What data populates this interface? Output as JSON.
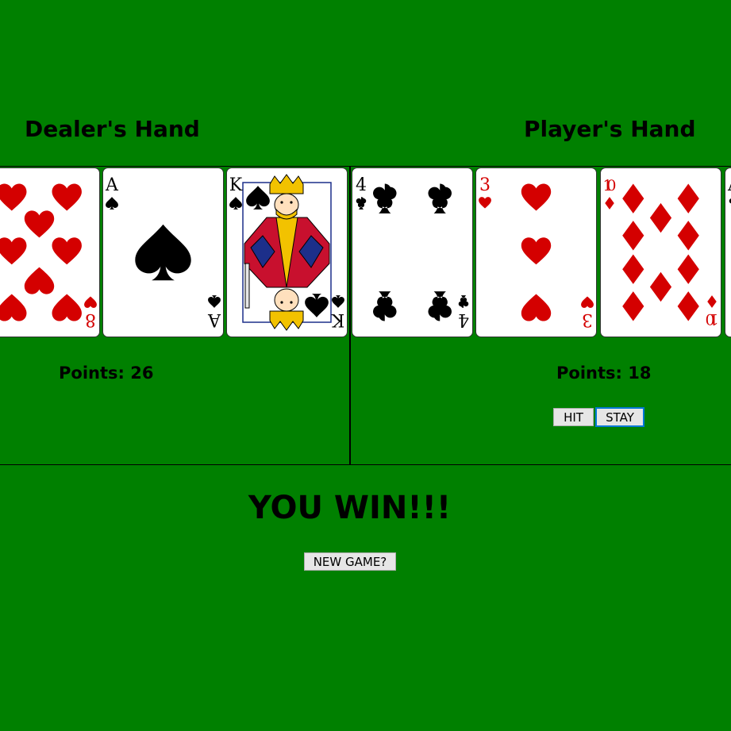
{
  "dealer": {
    "title": "Dealer's Hand",
    "points_label": "Points: 26",
    "cards": [
      {
        "rank": "8",
        "suit": "hearts"
      },
      {
        "rank": "A",
        "suit": "spades"
      },
      {
        "rank": "K",
        "suit": "spades"
      }
    ]
  },
  "player": {
    "title": "Player's Hand",
    "points_label": "Points: 18",
    "cards": [
      {
        "rank": "4",
        "suit": "clubs"
      },
      {
        "rank": "3",
        "suit": "hearts"
      },
      {
        "rank": "10",
        "suit": "diamonds"
      },
      {
        "rank": "A",
        "suit": "clubs"
      }
    ]
  },
  "controls": {
    "hit_label": "HIT",
    "stay_label": "STAY",
    "new_game_label": "NEW GAME?"
  },
  "result": {
    "message": "YOU WIN!!!"
  },
  "colors": {
    "table_green": "#008000",
    "red_suit": "#d40000",
    "black_suit": "#000000"
  }
}
